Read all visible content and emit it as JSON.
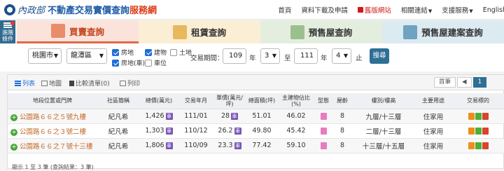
{
  "header": {
    "logo_text": "內政部",
    "title_main": "不動產交易實價查詢",
    "title_accent": "服務網",
    "nav": [
      "首頁",
      "資料下載及申請",
      "舊版網站",
      "相關連結",
      "支援服務",
      "English"
    ]
  },
  "sidebar_button": {
    "line1": "進階",
    "line2": "條件"
  },
  "tabs": [
    "買賣查詢",
    "租賃查詢",
    "預售屋查詢",
    "預售屋建案查詢"
  ],
  "filters": {
    "city": "桃園市",
    "district": "龍潭區",
    "checks": [
      {
        "label": "房地",
        "checked": true
      },
      {
        "label": "建物",
        "checked": true
      },
      {
        "label": "土地",
        "checked": false
      },
      {
        "label": "房地(車)",
        "checked": true
      },
      {
        "label": "車位",
        "checked": false
      }
    ],
    "period_label": "交易期間：",
    "start_year": "109",
    "year_unit": "年",
    "start_month": "3",
    "to_label": "至",
    "end_year": "111",
    "end_month": "4",
    "end_label": "止",
    "search_label": "搜尋"
  },
  "toolbar": {
    "list": "列表",
    "map": "地圖",
    "compare": "比較清單(0)",
    "print": "列印",
    "first_page": "首筆"
  },
  "table": {
    "headers": [
      "地段位置或門牌",
      "社區簡稱",
      "總價(萬元)",
      "交易年月",
      "單價(萬元/坪)",
      "總面積(坪)",
      "主建物佔比(%)",
      "型態",
      "屋齡",
      "樓別/樓高",
      "主要用途",
      "交易標的"
    ],
    "rows": [
      {
        "addr": "公園路６６之５號九樓",
        "community": "紀凡希",
        "total": "1,426",
        "date": "111/01",
        "unit": "28",
        "area": "51.01",
        "ratio": "46.02",
        "age": "8",
        "floor": "九層/十三層",
        "use": "住家用"
      },
      {
        "addr": "公園路６６之３號二樓",
        "community": "紀凡希",
        "total": "1,303",
        "date": "110/12",
        "unit": "26.2",
        "area": "49.80",
        "ratio": "45.42",
        "age": "8",
        "floor": "二層/十三層",
        "use": "住家用"
      },
      {
        "addr": "公園路６６之７號十三樓",
        "community": "紀凡希",
        "total": "1,806",
        "date": "110/09",
        "unit": "23.3",
        "area": "77.42",
        "ratio": "59.10",
        "age": "8",
        "floor": "十三層/十五層",
        "use": "住家用"
      }
    ],
    "tag_glyph": "車",
    "footer": "顯示 1 至 3 筆 (查詢結果：3 筆)"
  }
}
